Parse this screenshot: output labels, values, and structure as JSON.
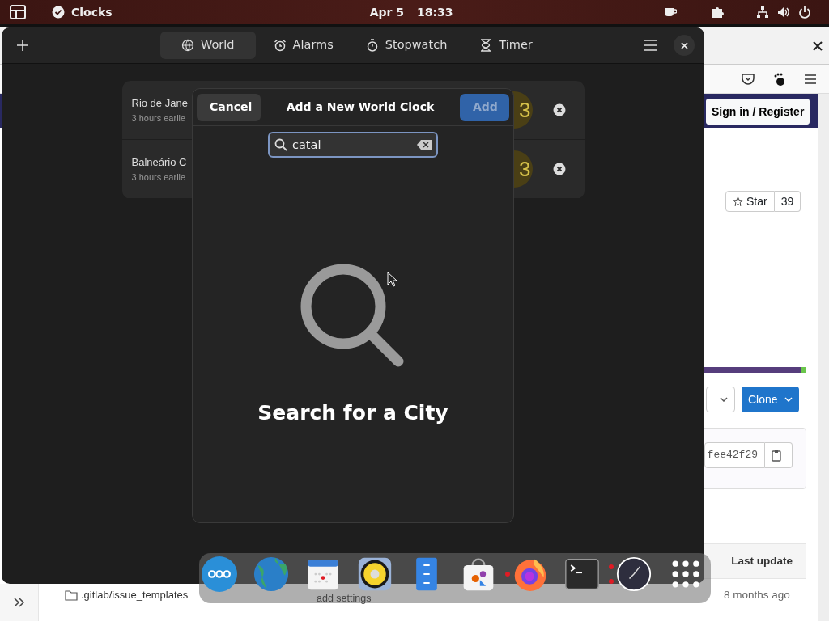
{
  "top_bar": {
    "app_name": "Clocks",
    "date": "Apr 5",
    "time": "18:33"
  },
  "browser": {
    "sign_in": "Sign in / Register",
    "star": {
      "label": "Star",
      "count": "39"
    },
    "clone": "Clone",
    "commit_id": "fee42f29",
    "table": {
      "column_header": "Last update",
      "file": ".gitlab/issue_templates",
      "commit_message": "add settings",
      "updated": "8 months ago"
    }
  },
  "clocks_window": {
    "tabs": [
      {
        "label": "World",
        "kind": "globe",
        "selected": true
      },
      {
        "label": "Alarms",
        "kind": "alarm",
        "selected": false
      },
      {
        "label": "Stopwatch",
        "kind": "stopwatch",
        "selected": false
      },
      {
        "label": "Timer",
        "kind": "timer",
        "selected": false
      }
    ],
    "world_clocks": [
      {
        "city": "Rio de Jane",
        "offset": "3 hours earlie",
        "time_fragment": "3"
      },
      {
        "city": "Balneário C",
        "offset": "3 hours earlie",
        "time_fragment": "3"
      }
    ],
    "dialog": {
      "title": "Add a New World Clock",
      "cancel": "Cancel",
      "add": {
        "label": "Add",
        "disabled": true
      },
      "search": {
        "value": "catal"
      },
      "empty_state": "Search for a City"
    }
  },
  "dock": [
    {
      "kind": "dots",
      "running": false,
      "multiple_windows": false
    },
    {
      "kind": "globe",
      "running": false,
      "multiple_windows": false
    },
    {
      "kind": "calendar",
      "running": false,
      "multiple_windows": false
    },
    {
      "kind": "speaker",
      "running": false,
      "multiple_windows": false
    },
    {
      "kind": "files",
      "running": false,
      "multiple_windows": false
    },
    {
      "kind": "store",
      "running": false,
      "multiple_windows": false
    },
    {
      "kind": "firefox",
      "running": true,
      "multiple_windows": false
    },
    {
      "kind": "terminal",
      "running": false,
      "multiple_windows": false
    },
    {
      "kind": "clock",
      "running": true,
      "multiple_windows": true
    },
    {
      "kind": "grid",
      "running": false,
      "multiple_windows": false
    }
  ]
}
